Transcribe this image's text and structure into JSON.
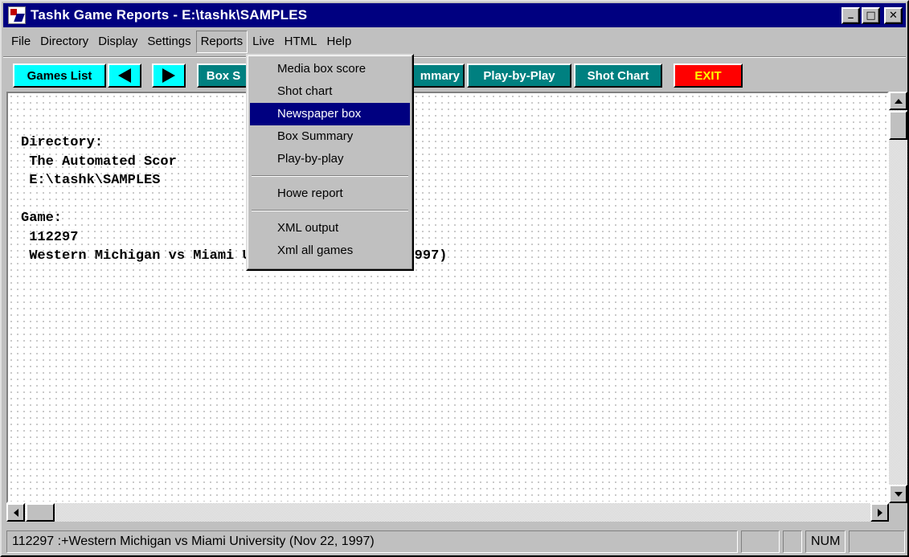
{
  "window": {
    "title": "Tashk Game Reports - E:\\tashk\\SAMPLES"
  },
  "caption_buttons": {
    "minimize": "_",
    "maximize": "□",
    "close": "✕"
  },
  "menubar": [
    {
      "label": "File"
    },
    {
      "label": "Directory"
    },
    {
      "label": "Display"
    },
    {
      "label": "Settings"
    },
    {
      "label": "Reports",
      "open": true
    },
    {
      "label": "Live"
    },
    {
      "label": "HTML"
    },
    {
      "label": "Help"
    }
  ],
  "toolbar": {
    "games_list": "Games List",
    "box_score": "Box S",
    "summary": "mmary",
    "play_by_play": "Play-by-Play",
    "shot_chart": "Shot Chart",
    "exit": "EXIT"
  },
  "reports_menu": {
    "items": [
      {
        "label": "Media box score"
      },
      {
        "label": "Shot chart"
      },
      {
        "label": "Newspaper box",
        "highlighted": true
      },
      {
        "label": "Box Summary"
      },
      {
        "label": "Play-by-play"
      },
      {
        "label": "Howe report"
      },
      {
        "label": "XML output"
      },
      {
        "label": "Xml all games"
      }
    ]
  },
  "content": {
    "text": "Directory:\n The Automated Scor\n E:\\tashk\\SAMPLES\n\nGame:\n 112297\n Western Michigan vs Miami University (Nov 22, 1997)"
  },
  "statusbar": {
    "message": "112297  :+Western Michigan vs Miami University (Nov 22, 1997)",
    "num": "NUM"
  }
}
